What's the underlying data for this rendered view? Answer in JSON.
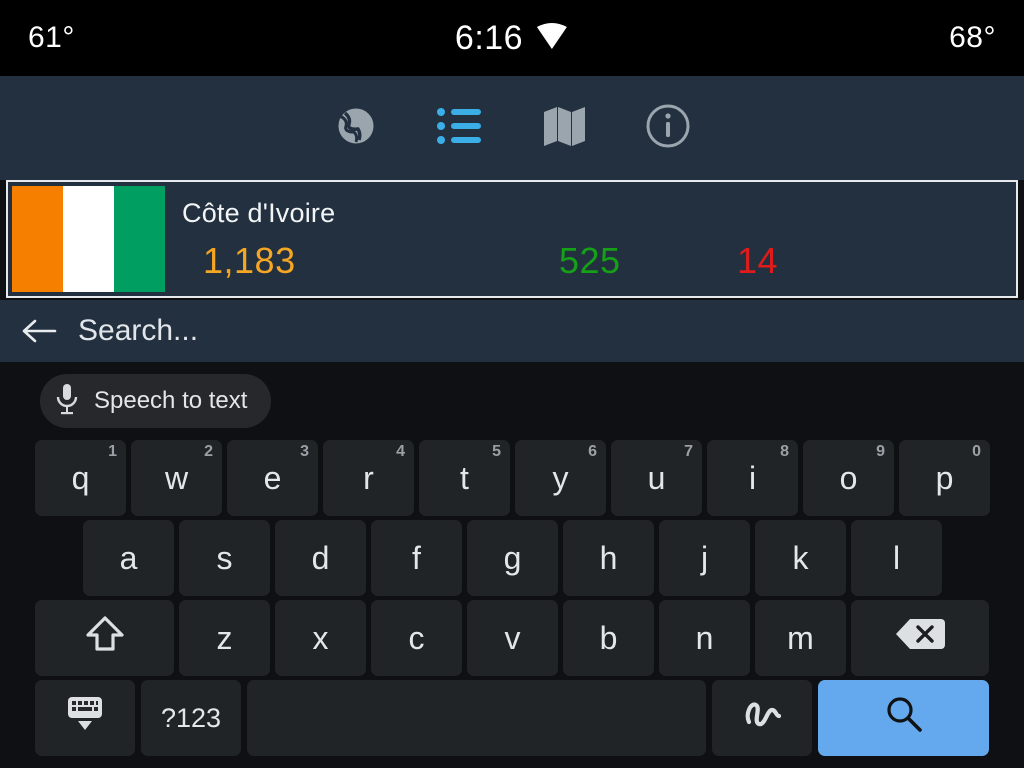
{
  "status_bar": {
    "temp_left": "61°",
    "clock": "6:16",
    "temp_right": "68°",
    "wifi_icon": "wifi-icon"
  },
  "nav": {
    "items": [
      {
        "name": "globe-icon",
        "label": "Globe",
        "active": false
      },
      {
        "name": "list-icon",
        "label": "List",
        "active": true
      },
      {
        "name": "map-icon",
        "label": "Map",
        "active": false
      },
      {
        "name": "info-icon",
        "label": "Info",
        "active": false
      }
    ],
    "active_color": "#3BAEE8",
    "inactive_color": "#9AA5AE"
  },
  "country_card": {
    "name": "Côte d'Ivoire",
    "flag": {
      "bands": [
        "#F77F00",
        "#FFFFFF",
        "#009E60"
      ]
    },
    "cases": "1,183",
    "recovered": "525",
    "deaths": "14",
    "cases_color": "#F5A623",
    "recovered_color": "#15A018",
    "deaths_color": "#E01B1B"
  },
  "search": {
    "back_icon": "arrow-left-icon",
    "value": "",
    "placeholder": "Search..."
  },
  "keyboard": {
    "suggestion": {
      "mic_icon": "microphone-icon",
      "label": "Speech to text"
    },
    "row1": [
      {
        "label": "q",
        "alt": "1"
      },
      {
        "label": "w",
        "alt": "2"
      },
      {
        "label": "e",
        "alt": "3"
      },
      {
        "label": "r",
        "alt": "4"
      },
      {
        "label": "t",
        "alt": "5"
      },
      {
        "label": "y",
        "alt": "6"
      },
      {
        "label": "u",
        "alt": "7"
      },
      {
        "label": "i",
        "alt": "8"
      },
      {
        "label": "o",
        "alt": "9"
      },
      {
        "label": "p",
        "alt": "0"
      }
    ],
    "row2": [
      {
        "label": "a"
      },
      {
        "label": "s"
      },
      {
        "label": "d"
      },
      {
        "label": "f"
      },
      {
        "label": "g"
      },
      {
        "label": "h"
      },
      {
        "label": "j"
      },
      {
        "label": "k"
      },
      {
        "label": "l"
      }
    ],
    "row3": [
      {
        "label": "z"
      },
      {
        "label": "x"
      },
      {
        "label": "c"
      },
      {
        "label": "v"
      },
      {
        "label": "b"
      },
      {
        "label": "n"
      },
      {
        "label": "m"
      }
    ],
    "shift_icon": "shift-icon",
    "backspace_icon": "backspace-icon",
    "hide_keyboard_icon": "hide-keyboard-icon",
    "symbols_label": "?123",
    "space_label": "",
    "handwriting_icon": "handwriting-icon",
    "enter_icon": "search-icon",
    "enter_color": "#64A9ED"
  }
}
